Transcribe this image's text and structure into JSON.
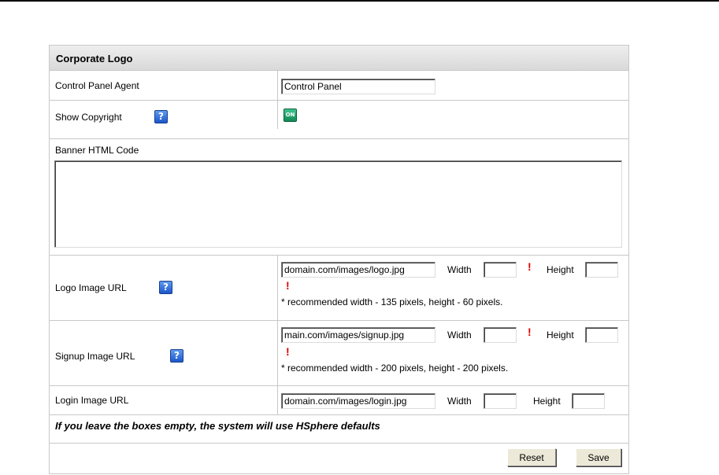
{
  "section_title": "Corporate Logo",
  "control_panel_agent": {
    "label": "Control Panel Agent",
    "value": "Control Panel"
  },
  "show_copyright": {
    "label": "Show Copyright",
    "help_icon": "?",
    "toggle_text": "ON",
    "toggle_state": "on"
  },
  "banner": {
    "label": "Banner HTML Code",
    "value": ""
  },
  "logo_image": {
    "label": "Logo Image URL",
    "help_icon": "?",
    "url_value": "domain.com/images/logo.jpg",
    "width_label": "Width",
    "width_value": "",
    "height_label": "Height",
    "height_value": "",
    "required_mark": "!",
    "note": "* recommended width - 135 pixels, height - 60 pixels."
  },
  "signup_image": {
    "label": "Signup Image URL",
    "help_icon": "?",
    "url_value": "main.com/images/signup.jpg",
    "width_label": "Width",
    "width_value": "",
    "height_label": "Height",
    "height_value": "",
    "required_mark": "!",
    "note": "* recommended width - 200 pixels, height - 200 pixels."
  },
  "login_image": {
    "label": "Login Image URL",
    "url_value": "domain.com/images/login.jpg",
    "width_label": "Width",
    "width_value": "",
    "height_label": "Height",
    "height_value": ""
  },
  "defaults_note": "If you leave the boxes empty, the system will use HSphere defaults",
  "buttons": {
    "reset": "Reset",
    "save": "Save"
  }
}
